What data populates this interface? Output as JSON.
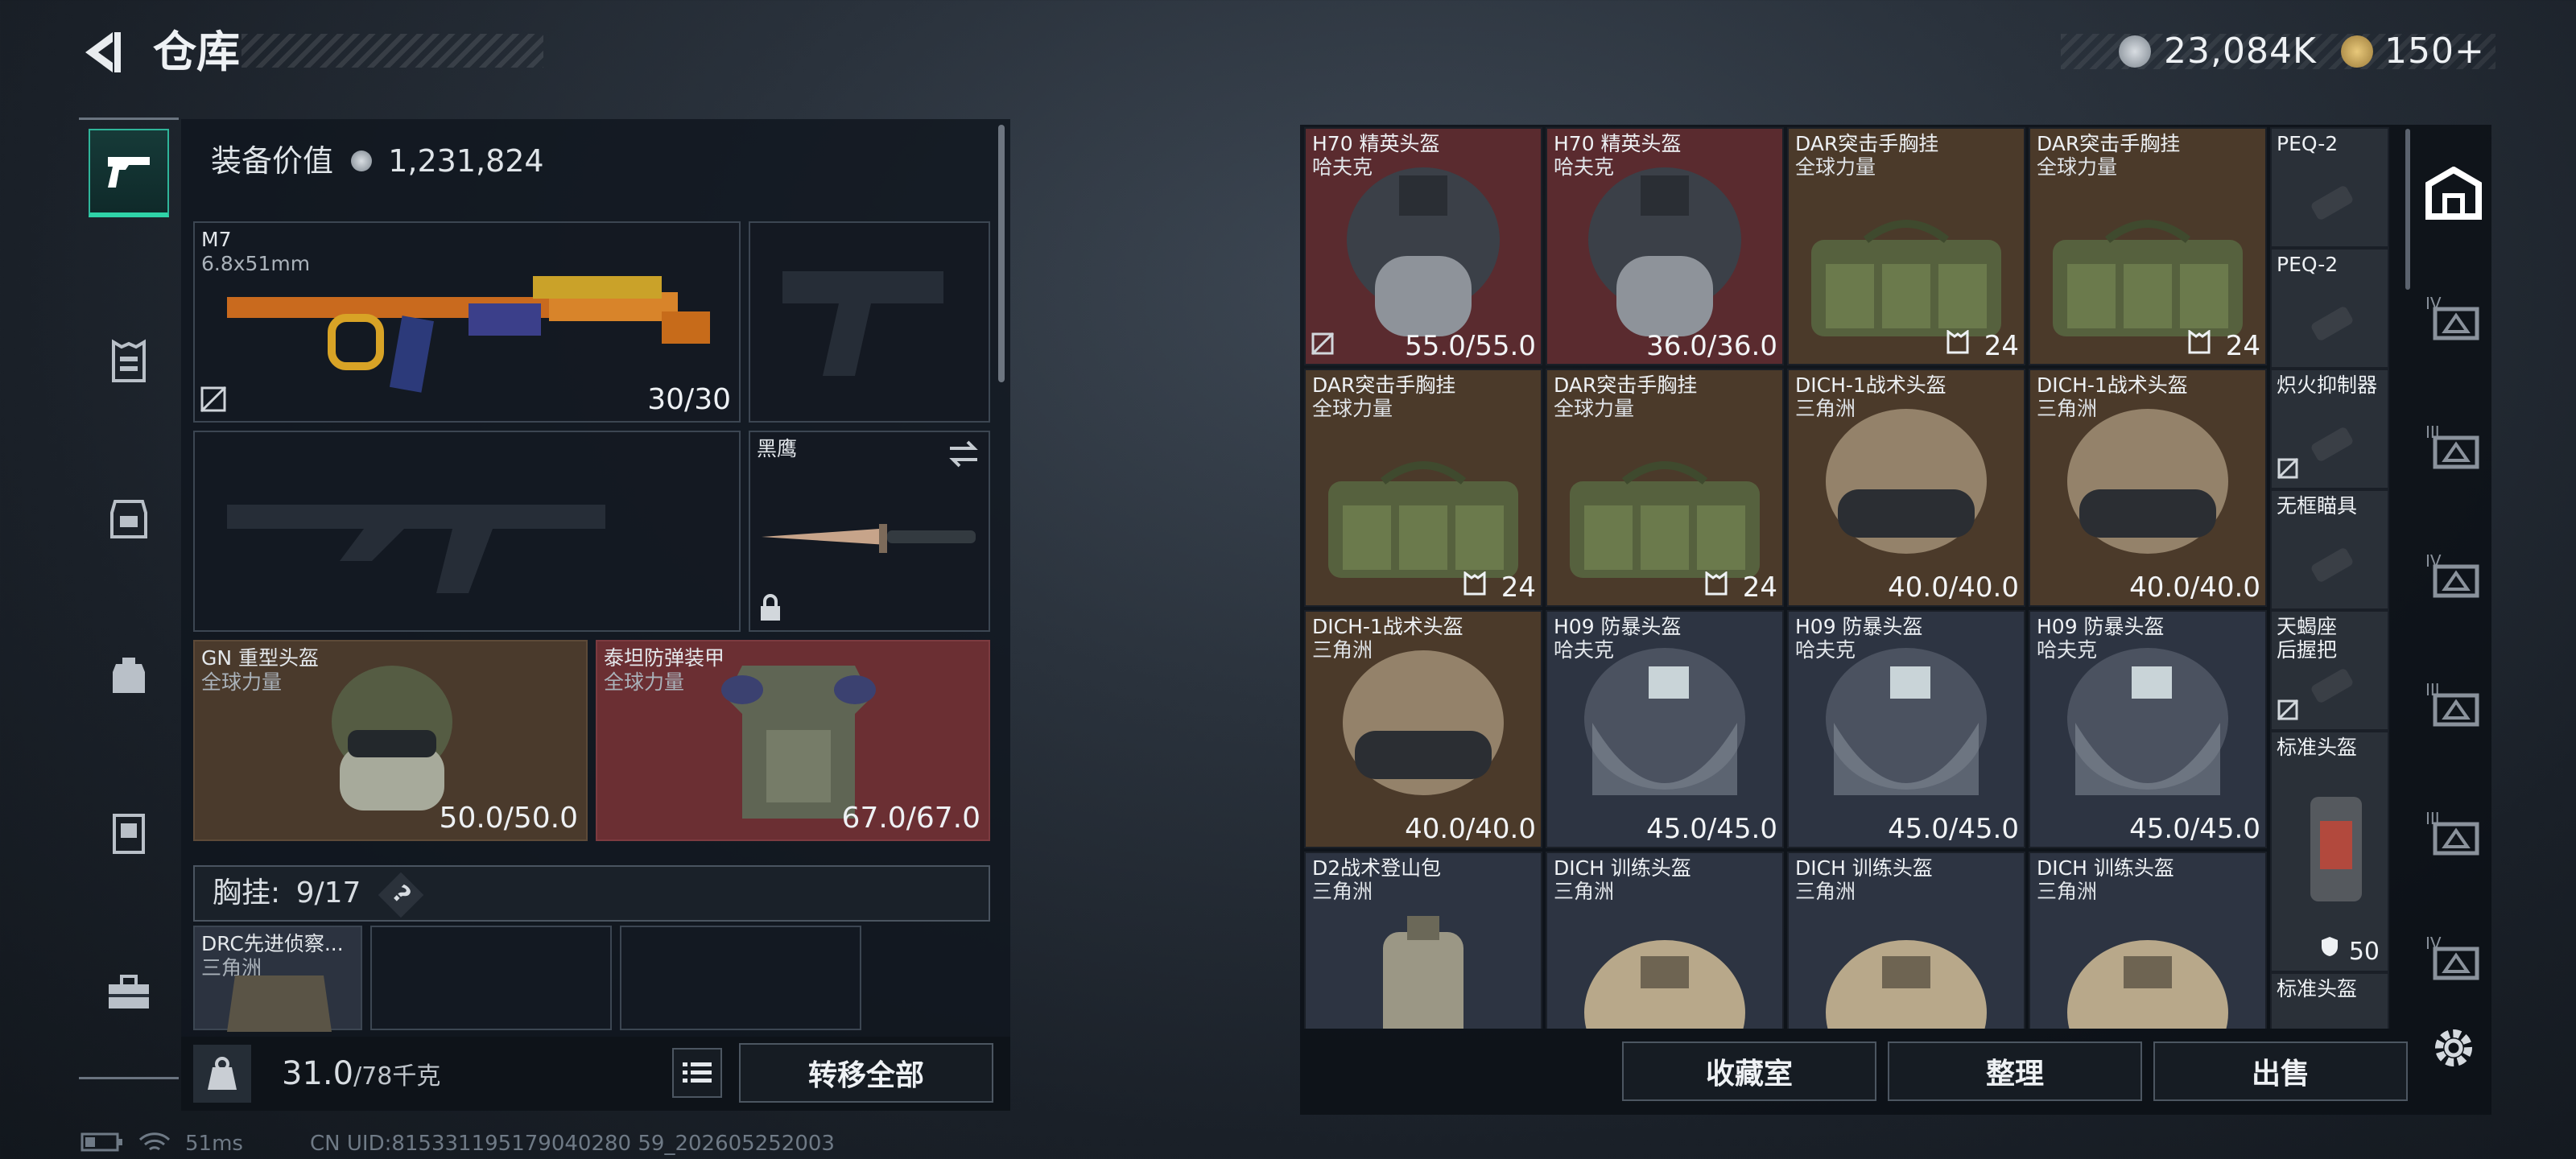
{
  "header": {
    "title": "仓库",
    "currency_1": "23,084K",
    "currency_2": "150+"
  },
  "sidebar": {
    "tabs": [
      "gun-icon",
      "armor-icon",
      "rig-icon",
      "backpack-icon",
      "storage-icon",
      "toolbox-icon"
    ],
    "active": "gun-icon"
  },
  "loadout": {
    "value_label": "装备价值",
    "value": "1,231,824",
    "primary": {
      "name": "M7",
      "caliber": "6.8x51mm",
      "durability": "30/30"
    },
    "melee": {
      "name": "黑鹰"
    },
    "helmet": {
      "name": "GN 重型头盔",
      "faction": "全球力量",
      "durability": "50.0/50.0"
    },
    "armor": {
      "name": "泰坦防弹装甲",
      "faction": "全球力量",
      "durability": "67.0/67.0"
    },
    "chest": {
      "label": "胸挂:",
      "count": "9/17",
      "help": "?",
      "item_name": "DRC先进侦察...",
      "item_faction": "三角洲"
    },
    "weight": "31.0",
    "weight_max": "/78千克",
    "transfer_all": "转移全部"
  },
  "stash": {
    "items": [
      {
        "name": "H70 精英头盔",
        "faction": "哈夫克",
        "value": "55.0/55.0",
        "bg": "#5a2b2f"
      },
      {
        "name": "H70 精英头盔",
        "faction": "哈夫克",
        "value": "36.0/36.0",
        "bg": "#5a2b2f"
      },
      {
        "name": "DAR突击手胸挂",
        "faction": "全球力量",
        "value": "24",
        "bg": "#4b3a2a"
      },
      {
        "name": "DAR突击手胸挂",
        "faction": "全球力量",
        "value": "24",
        "bg": "#4b3a2a"
      },
      {
        "name": "DAR突击手胸挂",
        "faction": "全球力量",
        "value": "24",
        "bg": "#4b3a2a"
      },
      {
        "name": "DAR突击手胸挂",
        "faction": "全球力量",
        "value": "24",
        "bg": "#4b3a2a"
      },
      {
        "name": "DICH-1战术头盔",
        "faction": "三角洲",
        "value": "40.0/40.0",
        "bg": "#4b3a2a"
      },
      {
        "name": "DICH-1战术头盔",
        "faction": "三角洲",
        "value": "40.0/40.0",
        "bg": "#4b3a2a"
      },
      {
        "name": "DICH-1战术头盔",
        "faction": "三角洲",
        "value": "40.0/40.0",
        "bg": "#4b3a2a"
      },
      {
        "name": "H09 防暴头盔",
        "faction": "哈夫克",
        "value": "45.0/45.0",
        "bg": "#2d3442"
      },
      {
        "name": "H09 防暴头盔",
        "faction": "哈夫克",
        "value": "45.0/45.0",
        "bg": "#2d3442"
      },
      {
        "name": "H09 防暴头盔",
        "faction": "哈夫克",
        "value": "45.0/45.0",
        "bg": "#2d3442"
      },
      {
        "name": "D2战术登山包",
        "faction": "三角洲",
        "value": "",
        "bg": "#2d3442"
      },
      {
        "name": "DICH 训练头盔",
        "faction": "三角洲",
        "value": "",
        "bg": "#2d3442"
      },
      {
        "name": "DICH 训练头盔",
        "faction": "三角洲",
        "value": "",
        "bg": "#2d3442"
      },
      {
        "name": "DICH 训练头盔",
        "faction": "三角洲",
        "value": "",
        "bg": "#2d3442"
      }
    ],
    "small_items": [
      {
        "name": "PEQ-2"
      },
      {
        "name": "PEQ-2"
      },
      {
        "name": "炽火抑制器"
      },
      {
        "name": "无框瞄具"
      },
      {
        "name": "天蝎座\n后握把"
      },
      {
        "name": "标准头盔",
        "value": "50"
      },
      {
        "name": "标准头盔"
      }
    ],
    "buttons": {
      "collection": "收藏室",
      "organize": "整理",
      "sell": "出售"
    }
  },
  "right_icons": [
    "home-icon",
    "IV",
    "III",
    "IV",
    "III",
    "III",
    "IV"
  ],
  "footer": {
    "ping": "51ms",
    "uid": "CN UID:815331195179040280 59_202605252003"
  }
}
